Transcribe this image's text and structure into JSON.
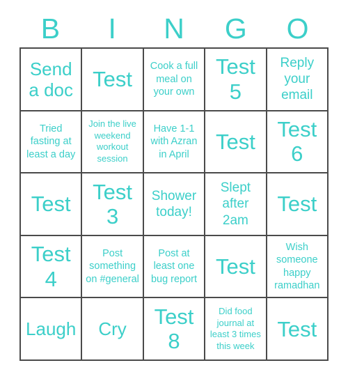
{
  "card": {
    "title_letters": [
      "B",
      "I",
      "N",
      "G",
      "O"
    ],
    "accent_color": "#3ccfc9",
    "border_color": "#4a4a4a",
    "cell_background": "#ffffff",
    "rows": 5,
    "columns": 5,
    "cells": [
      [
        {
          "text": "Send a doc",
          "size": "md"
        },
        {
          "text": "Test",
          "size": "lg"
        },
        {
          "text": "Cook a full meal on your own",
          "size": "xs"
        },
        {
          "text": "Test 5",
          "size": "lg"
        },
        {
          "text": "Reply your email",
          "size": "sm"
        }
      ],
      [
        {
          "text": "Tried fasting at least a day",
          "size": "xs"
        },
        {
          "text": "Join the live weekend workout session",
          "size": "xxs"
        },
        {
          "text": "Have 1-1 with Azran in April",
          "size": "xs"
        },
        {
          "text": "Test",
          "size": "lg"
        },
        {
          "text": "Test 6",
          "size": "lg"
        }
      ],
      [
        {
          "text": "Test",
          "size": "lg"
        },
        {
          "text": "Test 3",
          "size": "lg"
        },
        {
          "text": "Shower today!",
          "size": "sm"
        },
        {
          "text": "Slept after 2am",
          "size": "sm"
        },
        {
          "text": "Test",
          "size": "lg"
        }
      ],
      [
        {
          "text": "Test 4",
          "size": "lg"
        },
        {
          "text": "Post something on #general",
          "size": "xs"
        },
        {
          "text": "Post at least one bug report",
          "size": "xs"
        },
        {
          "text": "Test",
          "size": "lg"
        },
        {
          "text": "Wish someone happy ramadhan",
          "size": "xs"
        }
      ],
      [
        {
          "text": "Laugh",
          "size": "md"
        },
        {
          "text": "Cry",
          "size": "md"
        },
        {
          "text": "Test 8",
          "size": "lg"
        },
        {
          "text": "Did food journal at least 3 times this week",
          "size": "xxs"
        },
        {
          "text": "Test",
          "size": "lg"
        }
      ]
    ]
  }
}
